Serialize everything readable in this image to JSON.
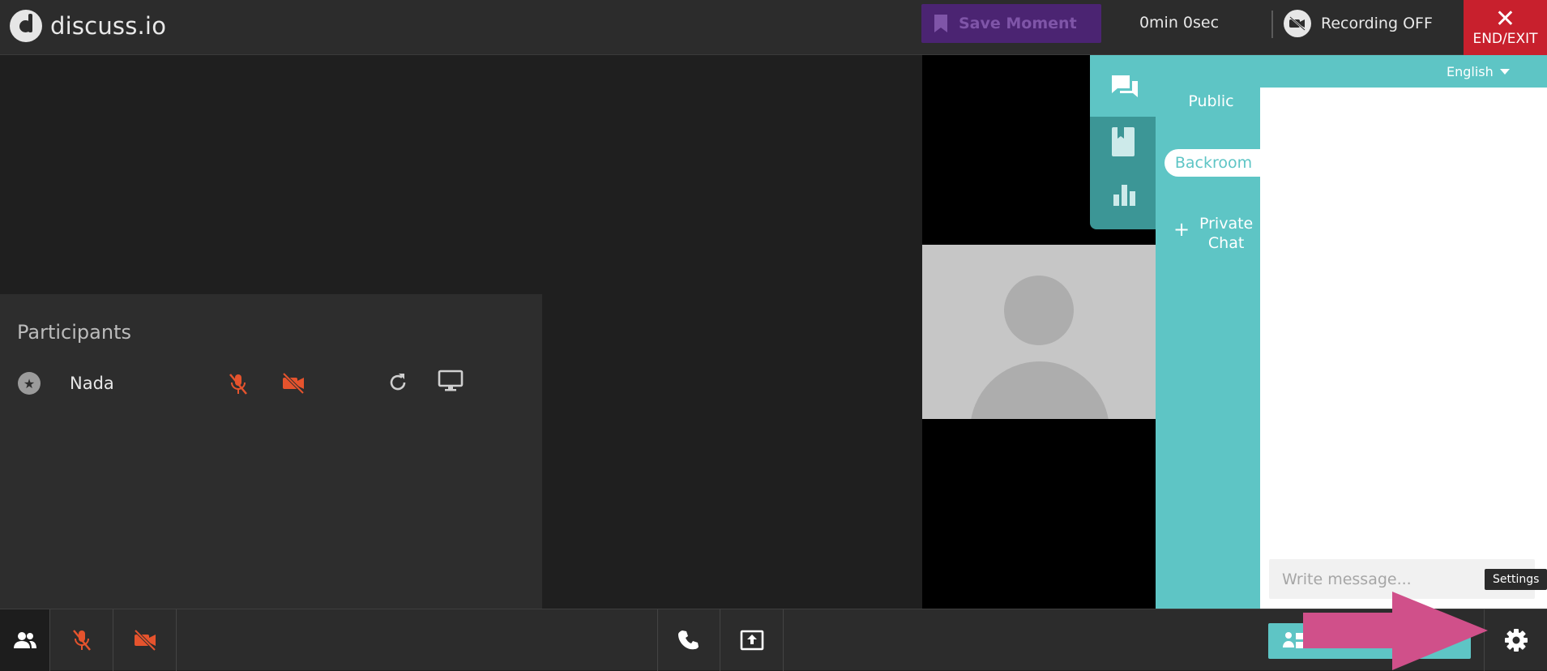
{
  "header": {
    "brand": "discuss.io",
    "save_moment": "Save Moment",
    "timer": "0min 0sec",
    "recording": "Recording OFF",
    "end_exit": "END/EXIT"
  },
  "participants": {
    "title": "Participants",
    "rows": [
      {
        "name": "Nada",
        "mic": "muted",
        "camera": "off"
      }
    ]
  },
  "chat": {
    "language": "English",
    "tabs": [
      {
        "label": "Public",
        "active": false
      },
      {
        "label": "Backroom",
        "active": true
      },
      {
        "label": "Private Chat",
        "active": false
      }
    ],
    "input_placeholder": "Write message...",
    "rail_icons": [
      "chat-bubbles-icon",
      "bookmark-book-icon",
      "bar-chart-icon"
    ]
  },
  "tooltip": {
    "settings": "Settings"
  },
  "colors": {
    "accent_teal": "#5ec5c5",
    "end_exit_red": "#c8202d",
    "save_moment_purple": "#4b2472",
    "muted_orange": "#e5532d",
    "highlight_arrow": "#d0508a"
  }
}
